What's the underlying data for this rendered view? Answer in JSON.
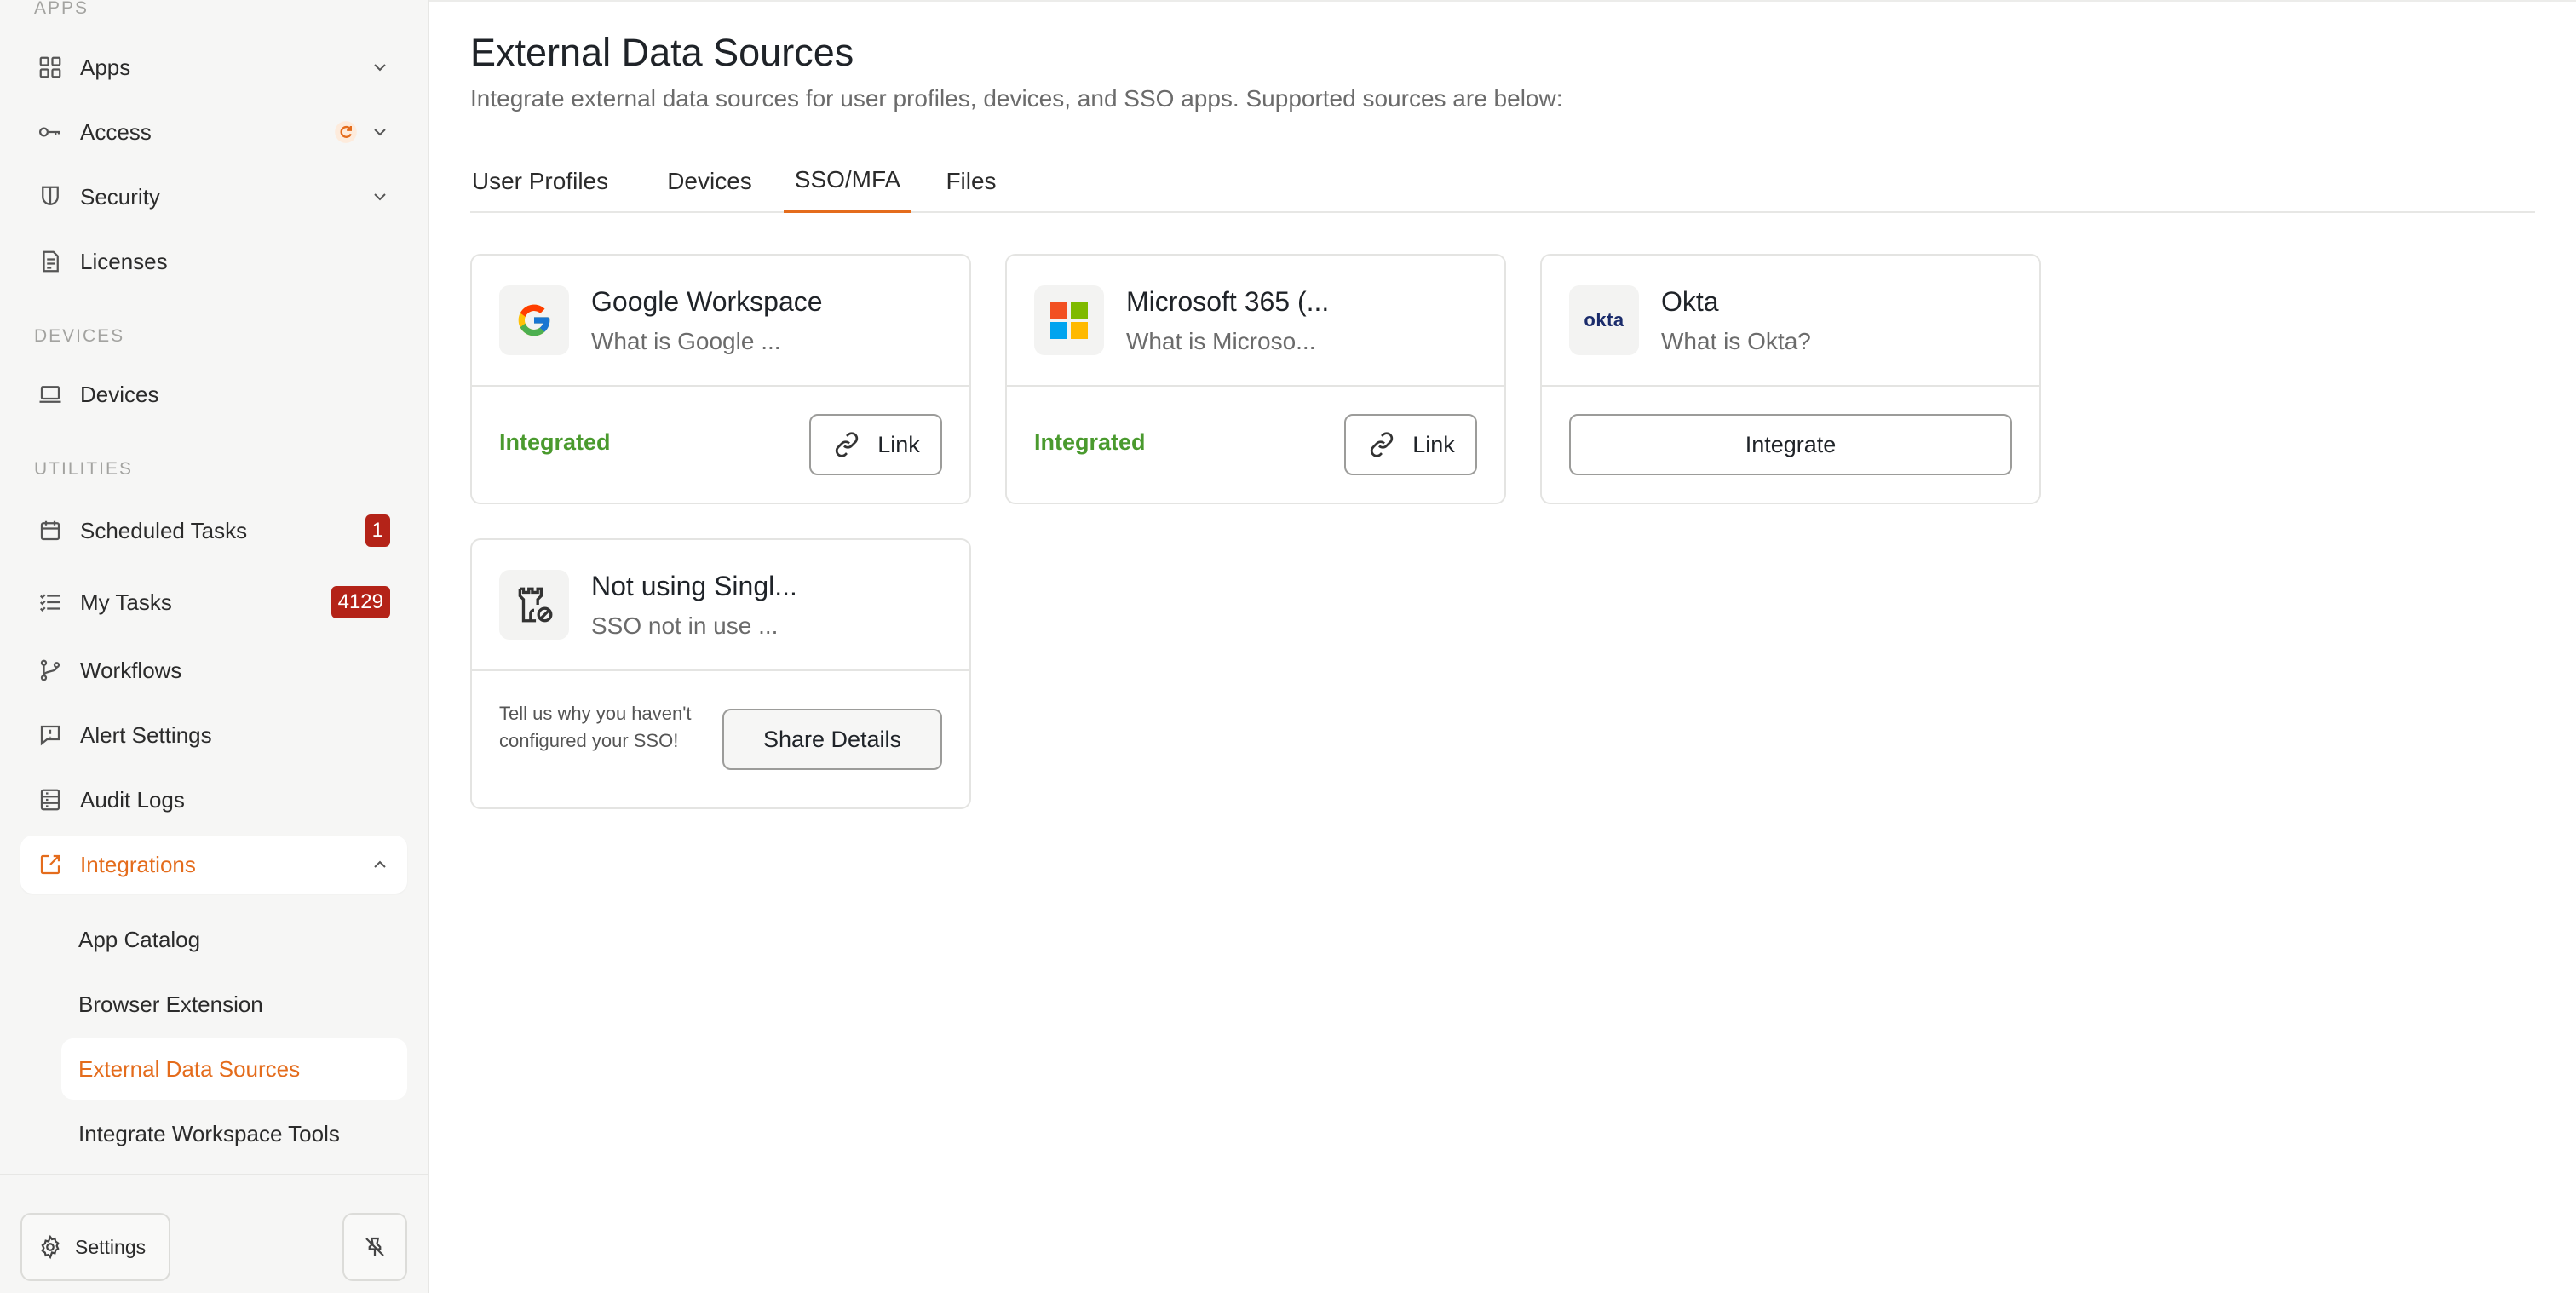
{
  "sidebar": {
    "sections": {
      "apps": "APPS",
      "devices": "DEVICES",
      "utilities": "UTILITIES"
    },
    "items": {
      "apps": "Apps",
      "access": "Access",
      "security": "Security",
      "licenses": "Licenses",
      "devices": "Devices",
      "scheduled_tasks": "Scheduled Tasks",
      "my_tasks": "My Tasks",
      "workflows": "Workflows",
      "alert_settings": "Alert Settings",
      "audit_logs": "Audit Logs",
      "integrations": "Integrations"
    },
    "badges": {
      "scheduled_tasks": "1",
      "my_tasks": "4129"
    },
    "sub_items": {
      "app_catalog": "App Catalog",
      "browser_extension": "Browser Extension",
      "external_data_sources": "External Data Sources",
      "integrate_workspace_tools": "Integrate Workspace Tools"
    },
    "footer": {
      "settings": "Settings"
    }
  },
  "header": {
    "title": "External Data Sources",
    "subtitle": "Integrate external data sources for user profiles, devices, and SSO apps. Supported sources are below:"
  },
  "tabs": {
    "user_profiles": "User Profiles",
    "devices": "Devices",
    "sso_mfa": "SSO/MFA",
    "files": "Files",
    "active": "SSO/MFA"
  },
  "cards": {
    "google": {
      "title": "Google Workspace",
      "desc": "What is Google ...",
      "status": "Integrated",
      "button": "Link"
    },
    "microsoft": {
      "title": "Microsoft 365 (...",
      "desc": "What is Microso...",
      "status": "Integrated",
      "button": "Link"
    },
    "okta": {
      "title": "Okta",
      "desc": "What is Okta?",
      "logo_text": "okta",
      "button": "Integrate"
    },
    "not_using": {
      "title": "Not using Singl...",
      "desc": "SSO not in use ...",
      "note": "Tell us why you haven't configured your SSO!",
      "button": "Share Details"
    }
  },
  "colors": {
    "accent": "#e46c1c",
    "success": "#4a9a2e",
    "badge": "#b42318"
  }
}
